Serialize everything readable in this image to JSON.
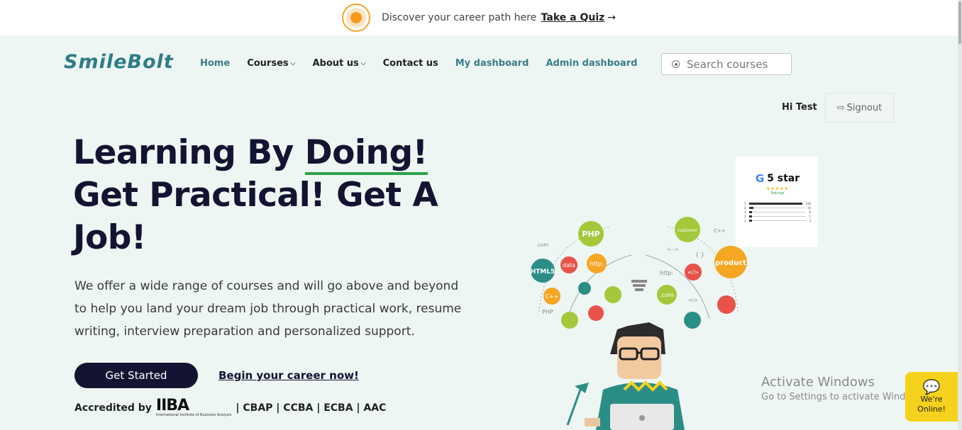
{
  "topbar": {
    "text": "Discover your career path here",
    "quiz_link": "Take a Quiz",
    "arrow": "→"
  },
  "logo": {
    "text": "SmileBolt"
  },
  "nav": {
    "home": "Home",
    "courses": "Courses",
    "about": "About us",
    "contact": "Contact us",
    "my_dashboard": "My dashboard",
    "admin_dashboard": "Admin dashboard"
  },
  "search": {
    "placeholder": "Search courses"
  },
  "user": {
    "greeting": "Hi Test",
    "signout": "Signout"
  },
  "hero": {
    "line1_prefix": "Learning By ",
    "line1_underlined": "Doing!",
    "line2": "Get Practical! Get A",
    "line3": "Job!",
    "description": "We offer a wide range of courses and will go above and beyond to help you land your dream job through practical work, resume writing, interview preparation and personalized support.",
    "cta_primary": "Get Started",
    "cta_secondary": "Begin your career now!",
    "accredited_label": "Accredited by",
    "iiba_logo_text": "IIBA",
    "iiba_sub": "International Institute of Business Analysis",
    "certifications": "| CBAP | CCBA | ECBA | AAC"
  },
  "rating_card": {
    "title": "5 star",
    "stars": "★★★★★",
    "label": "Ratings",
    "rows": [
      {
        "star": "5",
        "count": "236",
        "fraction": 1.0
      },
      {
        "star": "4",
        "count": "10",
        "fraction": 0.08
      },
      {
        "star": "3",
        "count": "6",
        "fraction": 0.06
      },
      {
        "star": "2",
        "count": "1",
        "fraction": 0.06
      },
      {
        "star": "1",
        "count": "3",
        "fraction": 0.06
      }
    ]
  },
  "illustration": {
    "bubbles": [
      "PHP",
      "data",
      "http:",
      "HTML5",
      "C++",
      "customer",
      "product",
      ".com",
      "</>",
      "{ }"
    ],
    "floating_text": [
      ".com",
      "PHP",
      "C++",
      "http:",
      "<--->",
      "</>"
    ]
  },
  "watermark": {
    "line1": "Activate Windows",
    "line2": "Go to Settings to activate Windows."
  },
  "chat": {
    "line1": "We're",
    "line2": "Online!"
  },
  "colors": {
    "accent_teal": "#3a7d8c",
    "dark_navy": "#151332",
    "underline_green": "#2ea34b",
    "chat_yellow": "#f5d21b",
    "page_bg": "#eef6f3"
  }
}
